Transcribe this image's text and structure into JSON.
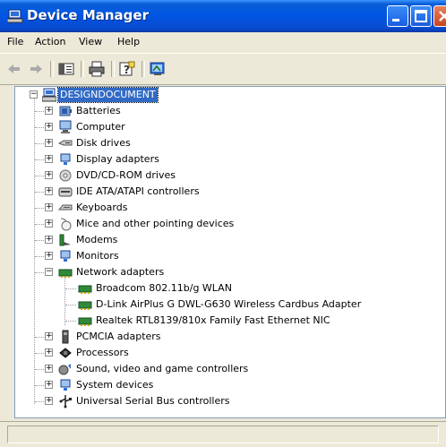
{
  "window": {
    "title": "Device Manager",
    "accent": "#0054e3",
    "selection_color": "#316ac5"
  },
  "menu": [
    {
      "label": "File"
    },
    {
      "label": "Action"
    },
    {
      "label": "View"
    },
    {
      "label": "Help"
    }
  ],
  "toolbar": [
    {
      "icon": "back-arrow-icon"
    },
    {
      "icon": "forward-arrow-icon"
    },
    {
      "icon": "properties-icon"
    },
    {
      "icon": "print-icon"
    },
    {
      "icon": "help-icon"
    },
    {
      "icon": "scan-hardware-icon"
    }
  ],
  "tree": {
    "root": {
      "label": "DESIGNDOCUMENT",
      "icon": "computer-icon",
      "expanded": true,
      "selected": true
    },
    "categories": [
      {
        "label": "Batteries",
        "icon": "battery-icon"
      },
      {
        "label": "Computer",
        "icon": "computer-icon"
      },
      {
        "label": "Disk drives",
        "icon": "disk-drive-icon"
      },
      {
        "label": "Display adapters",
        "icon": "display-adapter-icon"
      },
      {
        "label": "DVD/CD-ROM drives",
        "icon": "cdrom-icon"
      },
      {
        "label": "IDE ATA/ATAPI controllers",
        "icon": "ide-controller-icon"
      },
      {
        "label": "Keyboards",
        "icon": "keyboard-icon"
      },
      {
        "label": "Mice and other pointing devices",
        "icon": "mouse-icon"
      },
      {
        "label": "Modems",
        "icon": "modem-icon"
      },
      {
        "label": "Monitors",
        "icon": "monitor-icon"
      },
      {
        "label": "Network adapters",
        "icon": "network-adapter-icon",
        "expanded": true,
        "children": [
          {
            "label": "Broadcom 802.11b/g WLAN",
            "icon": "network-card-icon"
          },
          {
            "label": "D-Link AirPlus G DWL-G630 Wireless Cardbus Adapter",
            "icon": "network-card-icon"
          },
          {
            "label": "Realtek RTL8139/810x Family Fast Ethernet NIC",
            "icon": "network-card-icon"
          }
        ]
      },
      {
        "label": "PCMCIA adapters",
        "icon": "pcmcia-icon"
      },
      {
        "label": "Processors",
        "icon": "processor-icon"
      },
      {
        "label": "Sound, video and game controllers",
        "icon": "sound-icon"
      },
      {
        "label": "System devices",
        "icon": "system-device-icon"
      },
      {
        "label": "Universal Serial Bus controllers",
        "icon": "usb-icon"
      }
    ]
  }
}
